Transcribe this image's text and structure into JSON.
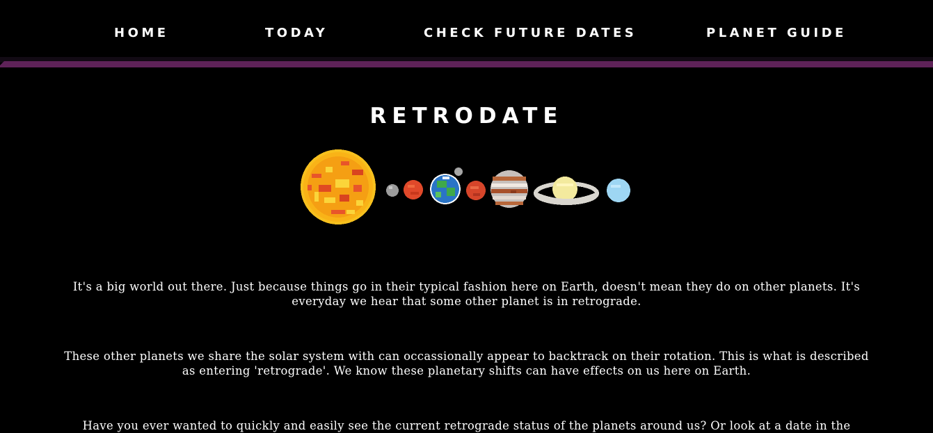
{
  "nav": {
    "items": [
      {
        "label": "HOME"
      },
      {
        "label": "TODAY"
      },
      {
        "label": "CHECK FUTURE DATES"
      },
      {
        "label": "PLANET GUIDE"
      }
    ]
  },
  "hero": {
    "title": "RETRODATE",
    "image_icon": "solar-system-pixel-art"
  },
  "intro": {
    "paragraphs": [
      "It's a big world out there. Just because things go in their typical fashion here on Earth, doesn't mean they do on other planets. It's everyday we hear that some other planet is in retrograde.",
      "These other planets we share the solar system with can occassionally appear to backtrack on their rotation. This is what is described as entering 'retrograde'. We know these planetary shifts can have effects on us here on Earth.",
      "Have you ever wanted to quickly and easily see the current retrograde status of the planets around us? Or look at a date in the future and"
    ]
  },
  "colors": {
    "background": "#000000",
    "accent": "#5e2258",
    "text": "#ffffff"
  }
}
